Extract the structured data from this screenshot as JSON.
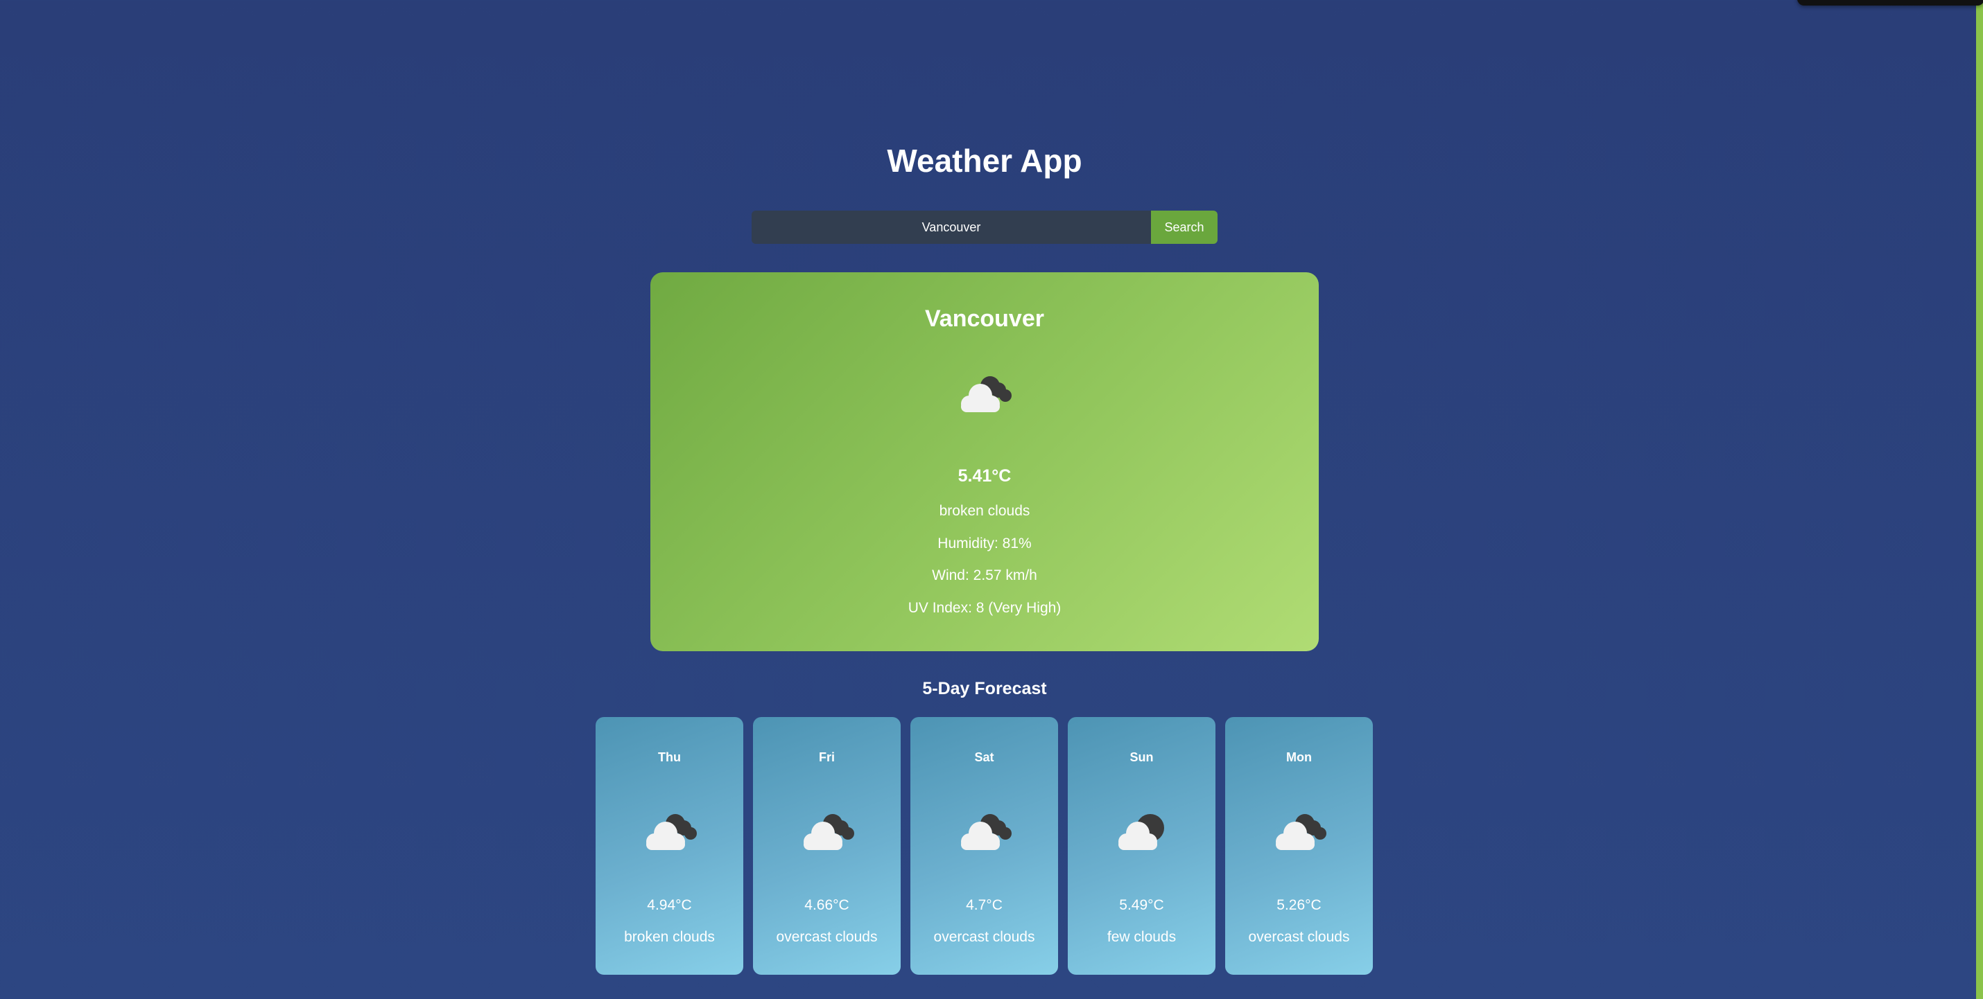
{
  "app": {
    "title": "Weather App"
  },
  "search": {
    "value": "Vancouver",
    "button_label": "Search"
  },
  "current": {
    "city": "Vancouver",
    "icon": "broken-clouds-icon",
    "temperature": "5.41°C",
    "description": "broken clouds",
    "humidity": "Humidity: 81%",
    "wind": "Wind: 2.57 km/h",
    "uv": "UV Index: 8 (Very High)"
  },
  "forecast": {
    "title": "5-Day Forecast",
    "days": [
      {
        "day": "Thu",
        "icon": "broken-clouds-icon",
        "temp": "4.94°C",
        "desc": "broken clouds"
      },
      {
        "day": "Fri",
        "icon": "overcast-clouds-icon",
        "temp": "4.66°C",
        "desc": "overcast clouds"
      },
      {
        "day": "Sat",
        "icon": "overcast-clouds-icon",
        "temp": "4.7°C",
        "desc": "overcast clouds"
      },
      {
        "day": "Sun",
        "icon": "few-clouds-icon",
        "temp": "5.49°C",
        "desc": "few clouds"
      },
      {
        "day": "Mon",
        "icon": "overcast-clouds-icon",
        "temp": "5.26°C",
        "desc": "overcast clouds"
      }
    ]
  },
  "colors": {
    "background": "#2d4682",
    "accent": "#6aa73d",
    "current_card": "#8fc45a",
    "forecast_card": "#6cb0cf",
    "search_input": "#323e50"
  }
}
